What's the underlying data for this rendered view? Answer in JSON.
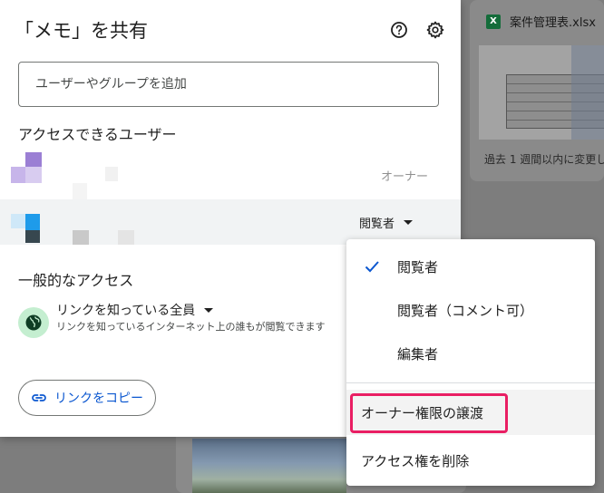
{
  "background": {
    "file": {
      "icon": "excel-icon",
      "icon_text": "X",
      "name": "案件管理表.xlsx"
    },
    "subtitle": "過去 1 週間以内に変更し"
  },
  "dialog": {
    "title": "「メモ」を共有",
    "help_icon": "help-icon",
    "settings_icon": "gear-icon",
    "add_people_placeholder": "ユーザーやグループを追加",
    "access_heading": "アクセスできるユーザー",
    "users": [
      {
        "role": "オーナー"
      },
      {
        "role": "閲覧者"
      }
    ],
    "general_access_heading": "一般的なアクセス",
    "link_setting": "リンクを知っている全員",
    "link_description": "リンクを知っているインターネット上の誰もが閲覧できます",
    "copy_link_label": "リンクをコピー"
  },
  "role_menu": {
    "items": [
      {
        "label": "閲覧者",
        "checked": true
      },
      {
        "label": "閲覧者（コメント可）",
        "checked": false
      },
      {
        "label": "編集者",
        "checked": false
      }
    ],
    "transfer_ownership": "オーナー権限の譲渡",
    "remove_access": "アクセス権を削除"
  },
  "colors": {
    "accent": "#0b57d0",
    "highlight": "#e91e63",
    "globe_bg": "#c4eed0"
  }
}
